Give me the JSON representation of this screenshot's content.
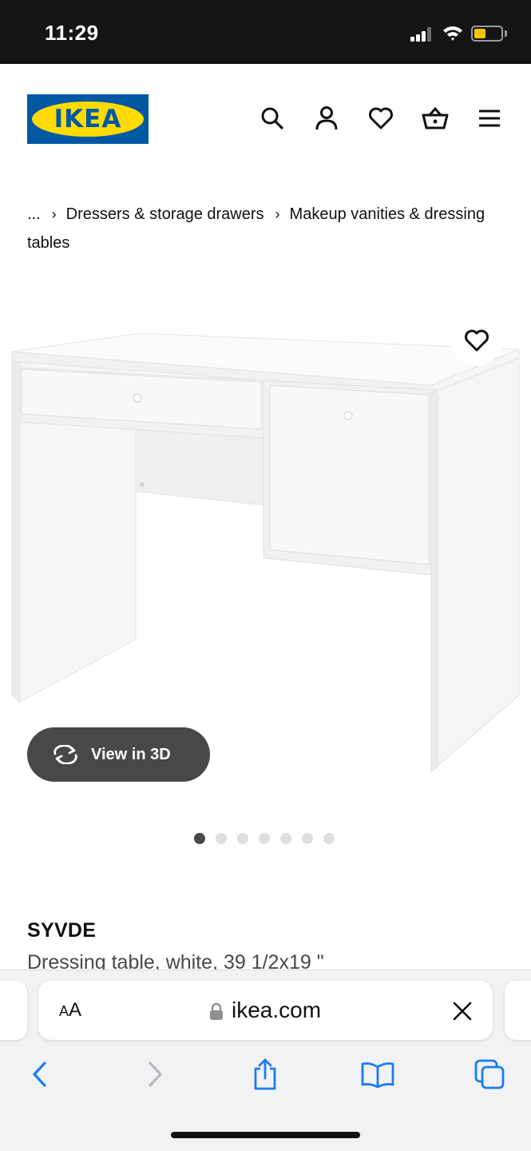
{
  "status_bar": {
    "time": "11:29",
    "battery_level": 0.45,
    "battery_color": "#f5c400"
  },
  "header": {
    "logo_text": "IKEA",
    "brand_blue": "#0058a3",
    "brand_yellow": "#ffdb00",
    "icons": [
      "search-icon",
      "account-icon",
      "wishlist-icon",
      "cart-icon",
      "menu-icon"
    ]
  },
  "breadcrumb": {
    "ellipsis": "...",
    "items": [
      "Dressers & storage drawers",
      "Makeup vanities & dressing tables"
    ]
  },
  "product": {
    "view_3d_label": "View in 3D",
    "gallery_count": 7,
    "gallery_active_index": 0,
    "name": "SYVDE",
    "description": "Dressing table, white, 39 1/2x19 \""
  },
  "browser": {
    "aa_label_small": "A",
    "aa_label_large": "A",
    "url": "ikea.com",
    "toolbar_icons": [
      "back-icon",
      "forward-icon",
      "share-icon",
      "bookmarks-icon",
      "tabs-icon"
    ]
  }
}
